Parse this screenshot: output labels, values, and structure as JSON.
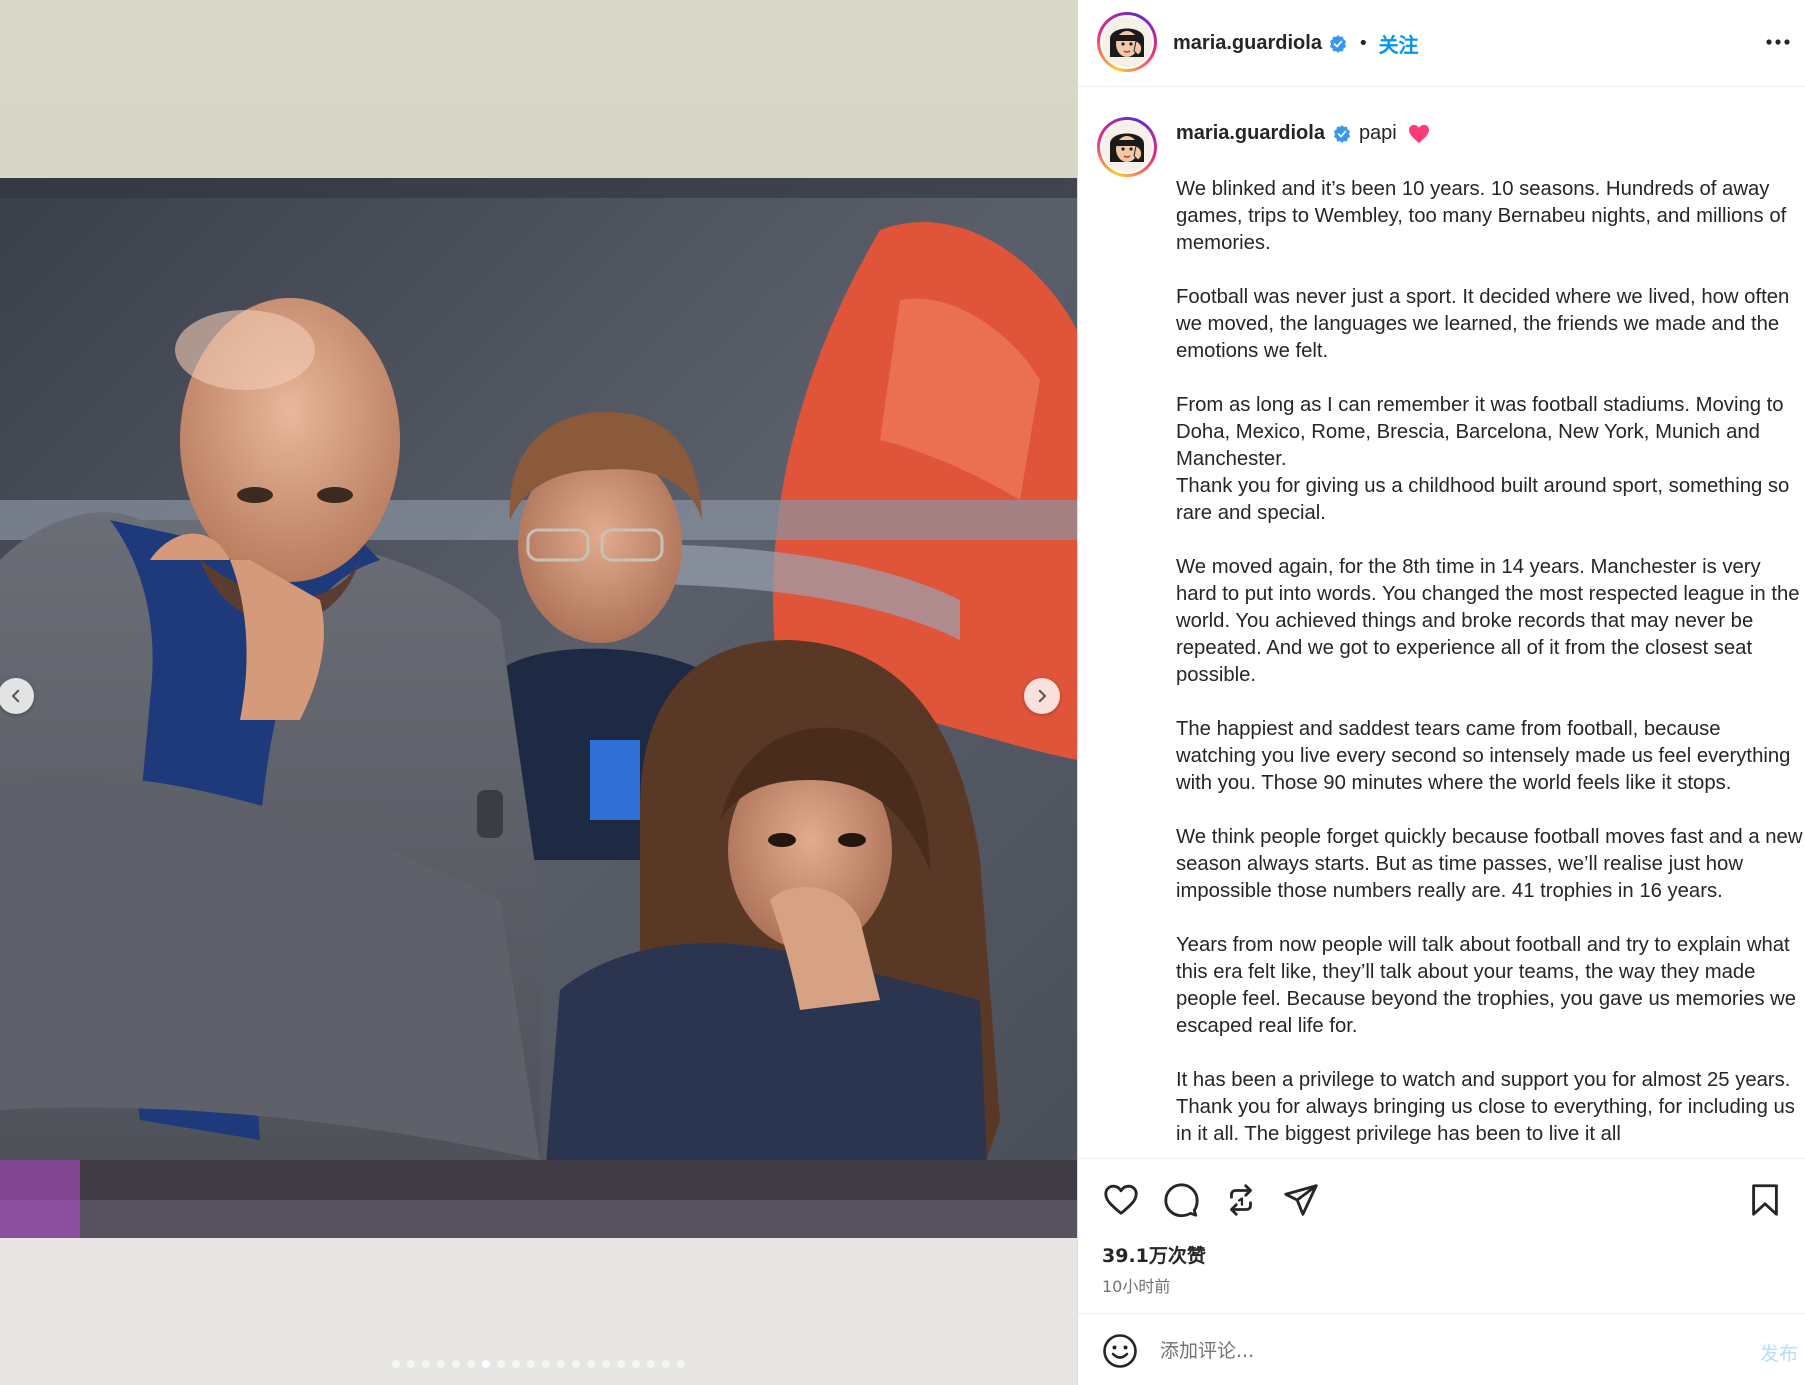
{
  "post": {
    "username": "maria.guardiola",
    "separator": "•",
    "follow_label": "关注",
    "caption_tag": "papi",
    "caption_paragraphs": [
      "We blinked and it’s been 10 years. 10 seasons. Hundreds of away games, trips to Wembley, too many Bernabeu nights, and millions of memories.",
      "Football was never just a sport. It decided where we lived, how often we moved, the languages we learned, the friends we made and the emotions we felt.",
      "From as long as I can remember it was football stadiums. Moving to Doha, Mexico, Rome, Brescia, Barcelona, New York, Munich and Manchester.\nThank you for giving us a childhood built around sport, something so rare and special.",
      "We moved again, for the 8th time in 14 years. Manchester is very hard to put into words. You changed the most respected league in the world. You achieved things and broke records that may never be repeated. And we got to experience all of it from the closest seat possible.",
      "The happiest and saddest tears came from football, because watching you live every second so intensely made us feel everything with you. Those 90 minutes where the world feels like it stops.",
      "We think people forget quickly because football moves fast and a new season always starts. But as time passes, we’ll realise just how impossible those numbers really are. 41 trophies in 16 years.",
      "Years from now people will talk about football and try to explain what this era felt like, they’ll talk about your teams, the way they made people feel. Because beyond the trophies, you gave us memories we escaped real life for.",
      "It has been a privilege to watch and support you for almost 25 years. Thank you for always bringing us close to everything, for including us in it all. The biggest privilege has been to live it all"
    ],
    "likes": "39.1万次赞",
    "time_ago": "10小时前"
  },
  "carousel": {
    "total_slides": 20,
    "active_index": 6
  },
  "composer": {
    "placeholder": "添加评论...",
    "post_label": "发布"
  },
  "icons": {
    "verified": "verified-badge-icon",
    "more": "more-options-icon",
    "like": "heart-icon",
    "comment": "comment-icon",
    "repost": "repost-icon",
    "share": "share-icon",
    "save": "bookmark-icon",
    "emoji": "emoji-icon",
    "prev": "chevron-left-icon",
    "next": "chevron-right-icon"
  },
  "colors": {
    "link_blue": "#0095f6",
    "verified_blue": "#3897f0",
    "heart_pink": "#ff3b7a",
    "post_disabled": "#b2dffc"
  }
}
